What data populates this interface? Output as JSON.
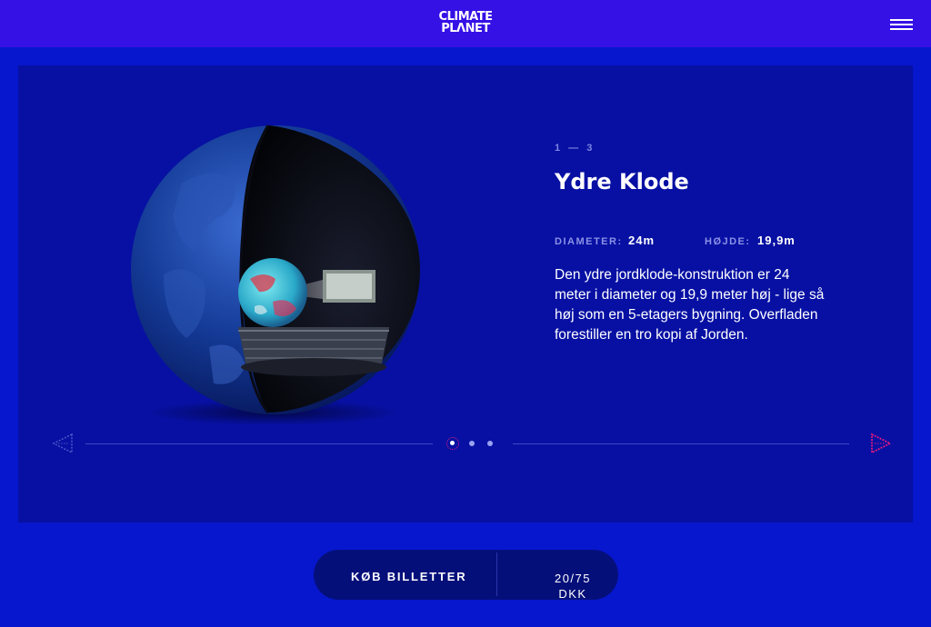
{
  "header": {
    "logo_line1": "CLIMATE",
    "logo_line2": "PLΛNET",
    "menu_icon": "hamburger-icon"
  },
  "slide": {
    "counter": "1 — 3",
    "title": "Ydre Klode",
    "stats": [
      {
        "label": "DIAMETER:",
        "value": "24m"
      },
      {
        "label": "HØJDE:",
        "value": "19,9m"
      }
    ],
    "description": "Den ydre jordklode-konstruktion er 24 meter i diameter og 19,9 meter høj - lige så høj som en 5-etagers bygning. Overfladen forestiller en tro kopi af Jorden.",
    "image_icon": "globe-cutaway-illustration"
  },
  "carousel": {
    "prev_icon": "triangle-left-icon",
    "next_icon": "triangle-right-icon",
    "total": 3,
    "active_index": 0
  },
  "ticket": {
    "label": "KØB BILLETTER",
    "price": "20/75 DKK"
  },
  "colors": {
    "page_bg": "#0717cd",
    "header_bg": "#3511e6",
    "panel_bg": "#0710a3",
    "accent": "#e0197f",
    "button_bg": "#050f7a"
  }
}
